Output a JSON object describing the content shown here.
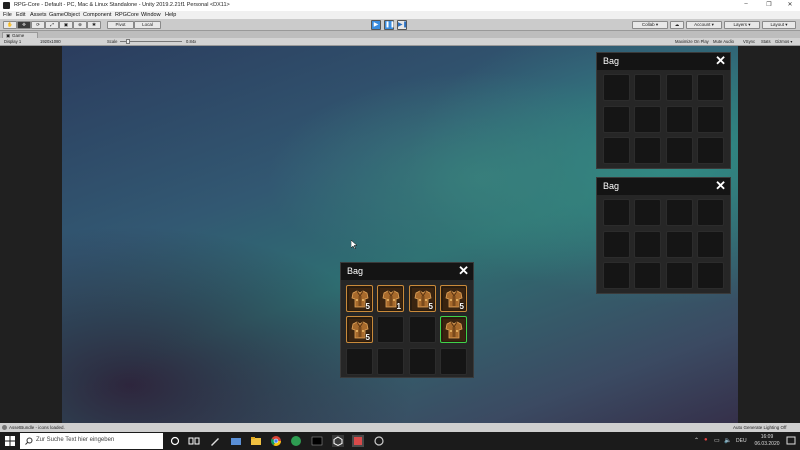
{
  "window": {
    "title": "RPG-Core - Default - PC, Mac & Linux Standalone - Unity 2019.2.21f1 Personal <DX11>",
    "minimize": "–",
    "maximize": "❐",
    "close": "✕"
  },
  "menu": [
    "File",
    "Edit",
    "Assets",
    "GameObject",
    "Component",
    "RPGCore",
    "Window",
    "Help"
  ],
  "toolbar": {
    "pivot_label": "Pivot",
    "local_label": "Local",
    "collab_label": "Collab ▾",
    "account_label": "Account ▾",
    "layers_label": "Layers ▾",
    "layout_label": "Layout ▾"
  },
  "game_tab": {
    "label": "Game"
  },
  "game_toolbar": {
    "display": "Display 1",
    "resolution": "1920x1080",
    "scale_label": "Scale",
    "scale_value": "0.84x",
    "maximize": "Maximize On Play",
    "mute": "Mute Audio",
    "vsync": "VSync",
    "stats": "Stats",
    "gizmos": "Gizmos ▾"
  },
  "bags": [
    {
      "title": "Bag",
      "close": "✕"
    },
    {
      "title": "Bag",
      "close": "✕"
    },
    {
      "title": "Bag",
      "close": "✕",
      "slots": [
        {
          "item": "armor",
          "qty": "5"
        },
        {
          "item": "armor",
          "qty": "1"
        },
        {
          "item": "armor",
          "qty": "5"
        },
        {
          "item": "armor",
          "qty": "5"
        },
        {
          "item": "armor",
          "qty": "5"
        },
        {
          "item": "",
          "qty": ""
        },
        {
          "item": "",
          "qty": ""
        },
        {
          "item": "armor",
          "qty": "",
          "selected": true
        },
        {
          "item": "",
          "qty": ""
        },
        {
          "item": "",
          "qty": ""
        },
        {
          "item": "",
          "qty": ""
        },
        {
          "item": "",
          "qty": ""
        }
      ]
    }
  ],
  "status": {
    "message": "AssetBundle - icons loaded.",
    "lighting": "Auto Generate Lighting Off"
  },
  "taskbar": {
    "search_placeholder": "Zur Suche Text hier eingeben",
    "language": "DEU",
    "time": "16:09",
    "date": "06.03.2020"
  },
  "colors": {
    "accent_blue": "#3a8de0",
    "slot_border_item": "#c98a3a",
    "slot_border_selected": "#3fd24a"
  }
}
